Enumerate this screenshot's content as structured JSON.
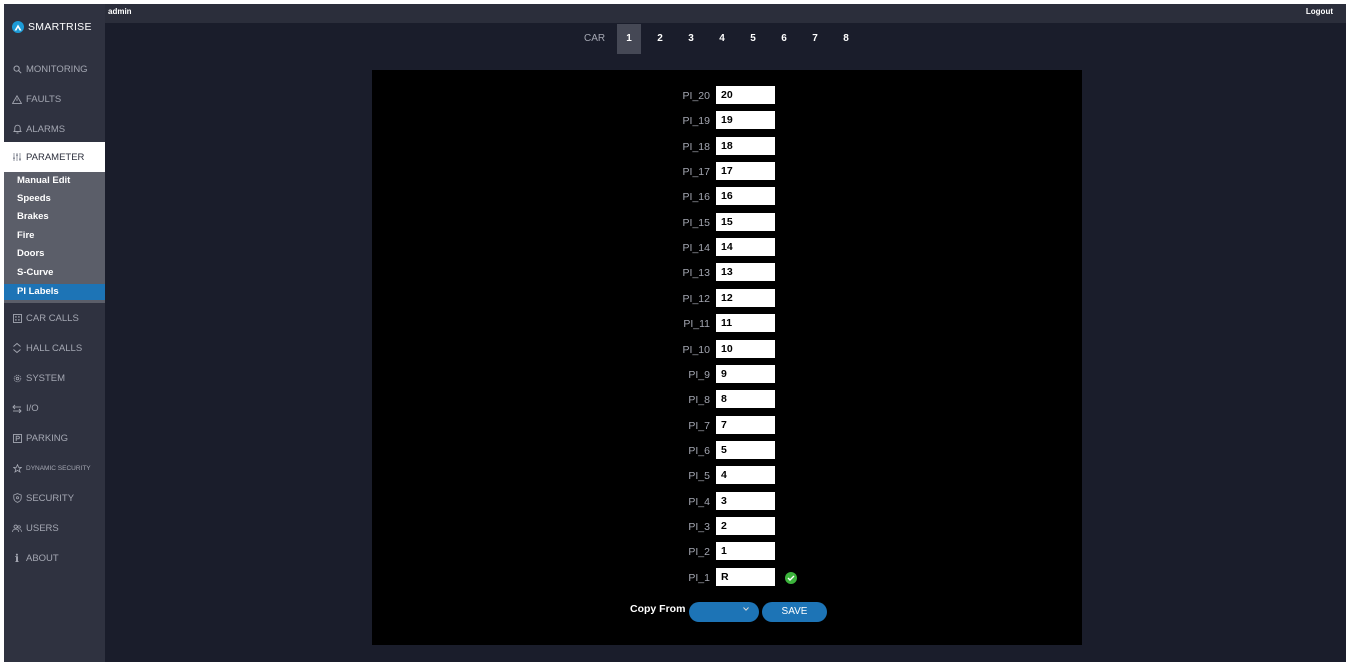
{
  "topbar": {
    "user": "admin",
    "logout": "Logout"
  },
  "brand": {
    "name": "SMARTRISE"
  },
  "nav": {
    "monitoring": "MONITORING",
    "faults": "FAULTS",
    "alarms": "ALARMS",
    "parameter": "PARAMETER",
    "car_calls": "CAR CALLS",
    "hall_calls": "HALL CALLS",
    "system": "SYSTEM",
    "io": "I/O",
    "parking": "PARKING",
    "dynamic_security": "DYNAMIC SECURITY",
    "security": "SECURITY",
    "users": "USERS",
    "about": "ABOUT"
  },
  "submenu": {
    "manual_edit": "Manual Edit",
    "speeds": "Speeds",
    "brakes": "Brakes",
    "fire": "Fire",
    "doors": "Doors",
    "s_curve": "S-Curve",
    "pi_labels": "PI Labels"
  },
  "car_tabs": {
    "label": "CAR",
    "tabs": [
      "1",
      "2",
      "3",
      "4",
      "5",
      "6",
      "7",
      "8"
    ],
    "active": "1"
  },
  "pi_rows": [
    {
      "label": "PI_20",
      "value": "20"
    },
    {
      "label": "PI_19",
      "value": "19"
    },
    {
      "label": "PI_18",
      "value": "18"
    },
    {
      "label": "PI_17",
      "value": "17"
    },
    {
      "label": "PI_16",
      "value": "16"
    },
    {
      "label": "PI_15",
      "value": "15"
    },
    {
      "label": "PI_14",
      "value": "14"
    },
    {
      "label": "PI_13",
      "value": "13"
    },
    {
      "label": "PI_12",
      "value": "12"
    },
    {
      "label": "PI_11",
      "value": "11"
    },
    {
      "label": "PI_10",
      "value": "10"
    },
    {
      "label": "PI_9",
      "value": "9"
    },
    {
      "label": "PI_8",
      "value": "8"
    },
    {
      "label": "PI_7",
      "value": "7"
    },
    {
      "label": "PI_6",
      "value": "5"
    },
    {
      "label": "PI_5",
      "value": "4"
    },
    {
      "label": "PI_4",
      "value": "3"
    },
    {
      "label": "PI_3",
      "value": "2"
    },
    {
      "label": "PI_2",
      "value": "1"
    },
    {
      "label": "PI_1",
      "value": "R"
    }
  ],
  "footer": {
    "copy_from": "Copy From",
    "copy_select_value": "",
    "save": "SAVE"
  },
  "colors": {
    "accent": "#1d74b6",
    "check": "#3cb43c",
    "background": "#1a1d2b",
    "panel": "#000000"
  }
}
